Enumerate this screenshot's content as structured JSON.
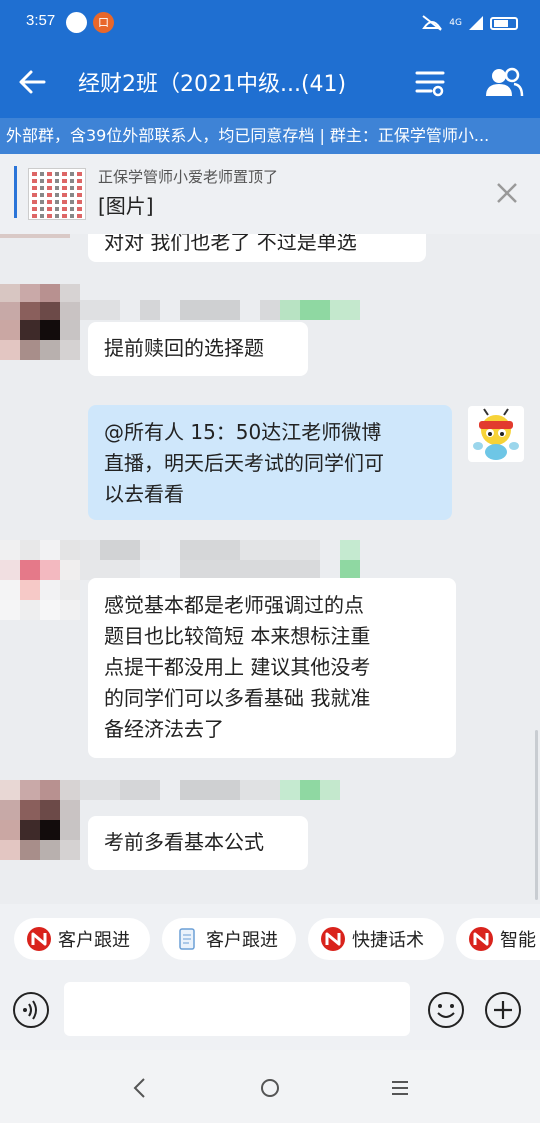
{
  "status": {
    "time": "3:57",
    "app_badge": "口",
    "signal": "4G"
  },
  "header": {
    "title": "经财2班（2021中级...(41)"
  },
  "info_bar": {
    "text": "外部群，含39位外部联系人，均已同意存档 | 群主：正保学管师小..."
  },
  "pinned": {
    "who": "正保学管师小爱老师置顶了",
    "content": "[图片]"
  },
  "messages": [
    {
      "text_lines": [
        "对对  我们也老了  不过是单选"
      ],
      "mine": false,
      "partial": true
    },
    {
      "text_lines": [
        "提前赎回的选择题"
      ],
      "mine": false
    },
    {
      "text_lines": [
        "@所有人  15：50达江老师微博",
        "直播，明天后天考试的同学们可",
        "以去看看"
      ],
      "mine": true
    },
    {
      "text_lines": [
        "感觉基本都是老师强调过的点",
        "题目也比较简短   本来想标注重",
        "点提干都没用上   建议其他没考",
        "的同学们可以多看基础   我就准",
        "备经济法去了"
      ],
      "mine": false
    },
    {
      "text_lines": [
        "考前多看基本公式"
      ],
      "mine": false
    }
  ],
  "quick_actions": [
    {
      "label": "客户跟进",
      "icon": "brand-n-icon"
    },
    {
      "label": "客户跟进",
      "icon": "document-icon"
    },
    {
      "label": "快捷话术",
      "icon": "brand-n-icon"
    },
    {
      "label": "智能",
      "icon": "brand-n-icon"
    }
  ],
  "input": {
    "value": ""
  },
  "colors": {
    "primary": "#1f6fd1",
    "bubble_mine": "#cfe7fb",
    "brand_red": "#d9231c"
  }
}
